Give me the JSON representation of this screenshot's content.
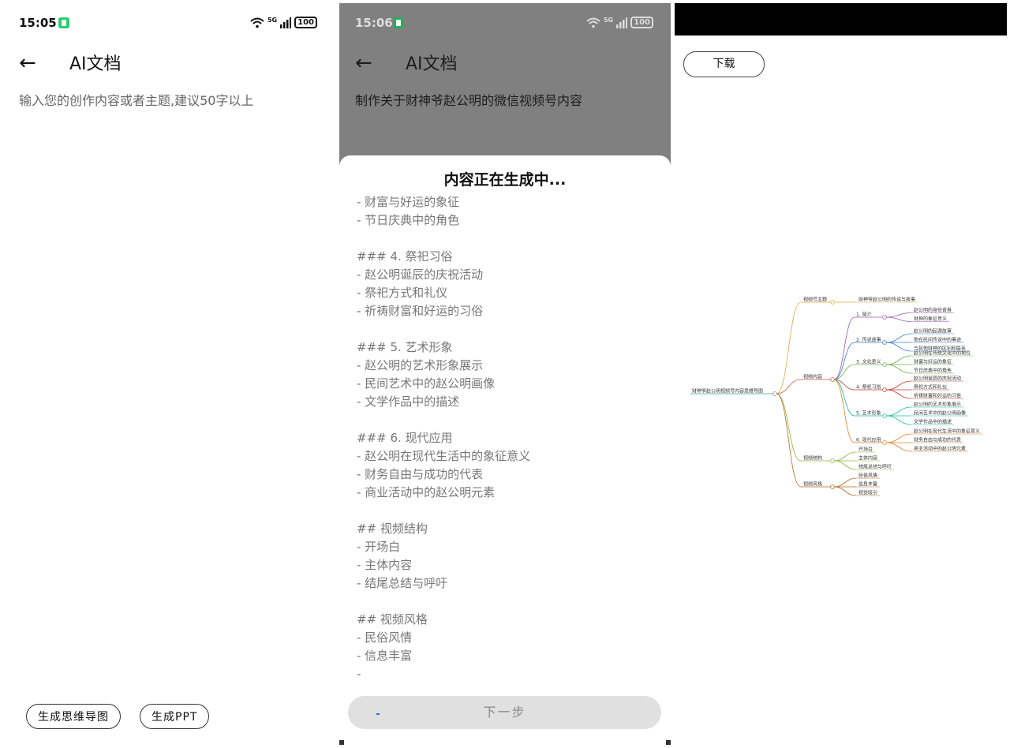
{
  "screen1": {
    "status": {
      "time": "15:05",
      "network": "5G",
      "battery": "100"
    },
    "appbar": {
      "title": "AI文档"
    },
    "prompt_placeholder": "输入您的创作内容或者主题,建议50字以上",
    "buttons": {
      "mindmap": "生成思维导图",
      "ppt": "生成PPT"
    }
  },
  "screen2": {
    "status": {
      "time": "15:06",
      "network": "5G",
      "battery": "100"
    },
    "appbar": {
      "title": "AI文档"
    },
    "prompt": "制作关于财神爷赵公明的微信视频号内容",
    "sheet_title": "内容正在生成中...",
    "lines": [
      "- 财富与好运的象征",
      "- 节日庆典中的角色",
      "",
      "### 4. 祭祀习俗",
      "- 赵公明诞辰的庆祝活动",
      "- 祭祀方式和礼仪",
      "- 祈祷财富和好运的习俗",
      "",
      "### 5. 艺术形象",
      "- 赵公明的艺术形象展示",
      "- 民间艺术中的赵公明画像",
      "- 文学作品中的描述",
      "",
      "### 6. 现代应用",
      "- 赵公明在现代生活中的象征意义",
      "- 财务自由与成功的代表",
      "- 商业活动中的赵公明元素",
      "",
      "## 视频结构",
      "- 开场白",
      "- 主体内容",
      "- 结尾总结与呼吁",
      "",
      "## 视频风格",
      "- 民俗风情",
      "- 信息丰富",
      "-"
    ],
    "next_button": "下一步"
  },
  "screen3": {
    "download_button": "下载",
    "mindmap": {
      "root": "财神爷赵公明视频号内容思维导图",
      "branches": [
        {
          "label": "视频号主题",
          "color": "#e8a33c",
          "children": [
            {
              "label": "财神爷赵公明的传说与故事",
              "children": []
            }
          ]
        },
        {
          "label": "视频内容",
          "color": "#c9573f",
          "children": [
            {
              "label": "1. 简介",
              "color": "#9b59b6",
              "children": [
                "赵公明的身份背景",
                "财神的象征意义"
              ]
            },
            {
              "label": "2. 传说故事",
              "color": "#3a7bd5",
              "children": [
                "赵公明的起源故事",
                "他在民间传说中的事迹",
                "与其他财神的区别和联系"
              ]
            },
            {
              "label": "3. 文化意义",
              "color": "#6ab04c",
              "children": [
                "赵公明在传统文化中的地位",
                "财富与好运的象征",
                "节日庆典中的角色"
              ]
            },
            {
              "label": "4. 祭祀习俗",
              "color": "#c0392b",
              "children": [
                "赵公明诞辰的庆祝活动",
                "祭祀方式和礼仪",
                "祈祷财富和好运的习俗"
              ]
            },
            {
              "label": "5. 艺术形象",
              "color": "#1abc9c",
              "children": [
                "赵公明的艺术形象展示",
                "民间艺术中的赵公明画像",
                "文学作品中的描述"
              ]
            },
            {
              "label": "6. 现代应用",
              "color": "#e67e22",
              "children": [
                "赵公明在现代生活中的象征意义",
                "财务自由与成功的代表",
                "商业活动中的赵公明元素"
              ]
            }
          ]
        },
        {
          "label": "视频结构",
          "color": "#8fb339",
          "children": [
            {
              "label": "开场白",
              "children": []
            },
            {
              "label": "主体内容",
              "children": []
            },
            {
              "label": "结尾总结与呼吁",
              "children": []
            }
          ]
        },
        {
          "label": "视频风格",
          "color": "#b5651d",
          "children": [
            {
              "label": "民俗风情",
              "children": []
            },
            {
              "label": "信息丰富",
              "children": []
            },
            {
              "label": "视觉吸引",
              "children": []
            }
          ]
        }
      ]
    }
  }
}
